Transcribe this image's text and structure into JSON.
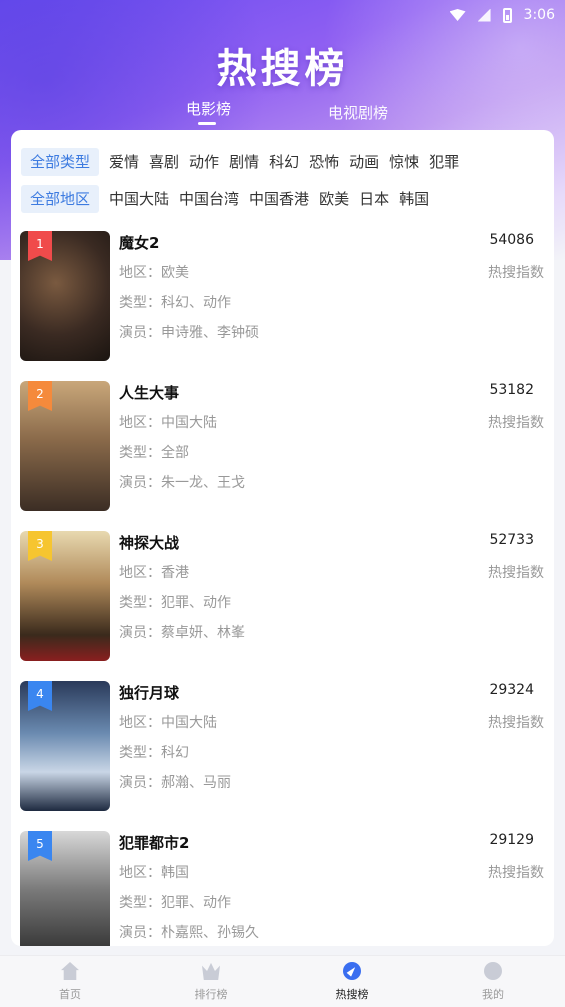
{
  "status_bar": {
    "time": "3:06"
  },
  "header": {
    "title": "热搜榜",
    "tabs": [
      {
        "label": "电影榜",
        "active": true
      },
      {
        "label": "电视剧榜",
        "active": false
      }
    ]
  },
  "filters": {
    "types": [
      "全部类型",
      "爱情",
      "喜剧",
      "动作",
      "剧情",
      "科幻",
      "恐怖",
      "动画",
      "惊悚",
      "犯罪"
    ],
    "regions": [
      "全部地区",
      "中国大陆",
      "中国台湾",
      "中国香港",
      "欧美",
      "日本",
      "韩国"
    ],
    "active_type": "全部类型",
    "active_region": "全部地区"
  },
  "labels": {
    "region": "地区：",
    "type": "类型：",
    "actors": "演员：",
    "score_label": "热搜指数"
  },
  "items": [
    {
      "rank": "1",
      "title": "魔女2",
      "score": "54086",
      "region": "欧美",
      "type": "科幻、动作",
      "actors": "申诗雅、李钟硕",
      "rank_color": "#f04b4b"
    },
    {
      "rank": "2",
      "title": "人生大事",
      "score": "53182",
      "region": "中国大陆",
      "type": "全部",
      "actors": "朱一龙、王戈",
      "rank_color": "#f58a3c"
    },
    {
      "rank": "3",
      "title": "神探大战",
      "score": "52733",
      "region": "香港",
      "type": "犯罪、动作",
      "actors": "蔡卓妍、林峯",
      "rank_color": "#f6c530"
    },
    {
      "rank": "4",
      "title": "独行月球",
      "score": "29324",
      "region": "中国大陆",
      "type": "科幻",
      "actors": "郝瀚、马丽",
      "rank_color": "#3a86f0"
    },
    {
      "rank": "5",
      "title": "犯罪都市2",
      "score": "29129",
      "region": "韩国",
      "type": "犯罪、动作",
      "actors": "朴嘉熙、孙锡久",
      "rank_color": "#3a86f0"
    }
  ],
  "bottom_nav": [
    {
      "label": "首页",
      "icon": "home-icon",
      "active": false
    },
    {
      "label": "排行榜",
      "icon": "crown-icon",
      "active": false
    },
    {
      "label": "热搜榜",
      "icon": "compass-icon",
      "active": true
    },
    {
      "label": "我的",
      "icon": "user-icon",
      "active": false
    }
  ],
  "colors": {
    "accent": "#3d7be0",
    "header_gradient_start": "#6a4cf0",
    "header_gradient_end": "#e4d6fa"
  }
}
